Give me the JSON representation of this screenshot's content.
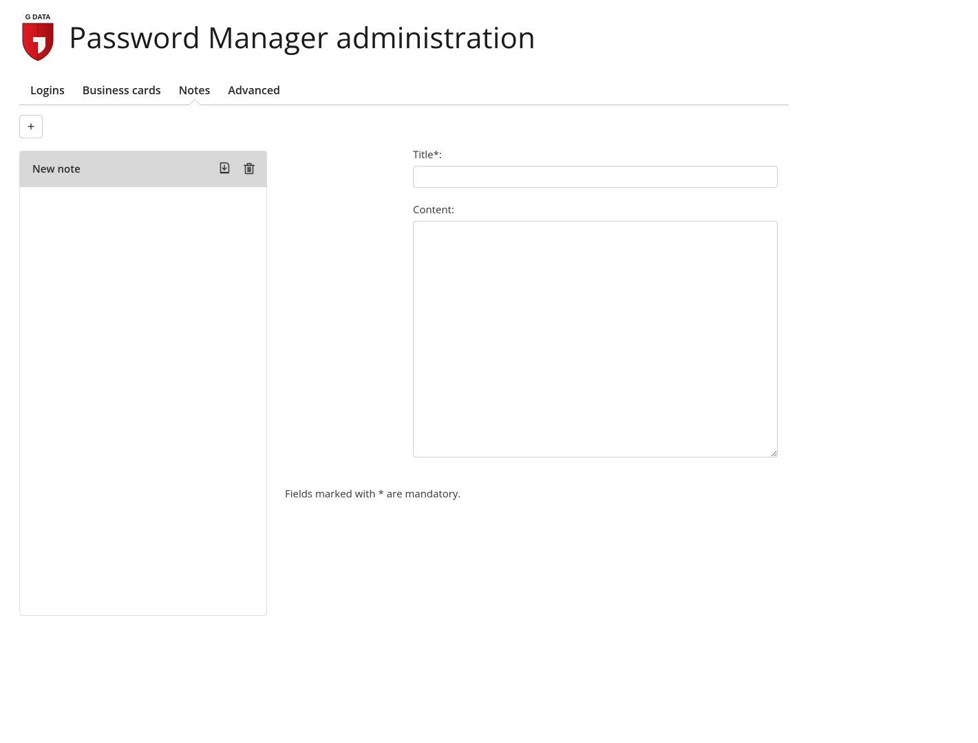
{
  "header": {
    "logo_text": "G DATA",
    "title": "Password Manager administration"
  },
  "tabs": [
    {
      "id": "logins",
      "label": "Logins",
      "active": false
    },
    {
      "id": "bizcards",
      "label": "Business cards",
      "active": false
    },
    {
      "id": "notes",
      "label": "Notes",
      "active": true
    },
    {
      "id": "advanced",
      "label": "Advanced",
      "active": false
    }
  ],
  "toolbar": {
    "add_label": "+"
  },
  "notes_list": {
    "items": [
      {
        "title": "New note"
      }
    ]
  },
  "form": {
    "title_label": "Title*:",
    "title_value": "",
    "content_label": "Content:",
    "content_value": ""
  },
  "footer": {
    "mandatory_text": "Fields marked with * are mandatory."
  },
  "icons": {
    "save": "save-icon",
    "delete": "trash-icon"
  },
  "colors": {
    "brand_red": "#c6151b"
  }
}
